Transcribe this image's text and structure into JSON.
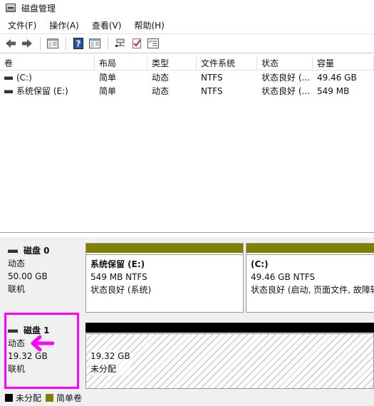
{
  "window": {
    "title": "磁盘管理"
  },
  "menu": [
    "文件(F)",
    "操作(A)",
    "查看(V)",
    "帮助(H)"
  ],
  "volumes": {
    "headers": [
      "卷",
      "布局",
      "类型",
      "文件系统",
      "状态",
      "容量"
    ],
    "rows": [
      {
        "name": "(C:)",
        "layout": "简单",
        "type": "动态",
        "fs": "NTFS",
        "status": "状态良好 (...",
        "capacity": "49.46 GB"
      },
      {
        "name": "系统保留 (E:)",
        "layout": "简单",
        "type": "动态",
        "fs": "NTFS",
        "status": "状态良好 (...",
        "capacity": "549 MB"
      }
    ]
  },
  "disks": [
    {
      "name": "磁盘 0",
      "type": "动态",
      "size": "50.00 GB",
      "state": "联机",
      "partitions": [
        {
          "name": "系统保留  (E:)",
          "size": "549 MB NTFS",
          "status": "状态良好 (系统)"
        },
        {
          "name": "(C:)",
          "size": "49.46 GB NTFS",
          "status": "状态良好 (启动, 页面文件, 故障转"
        }
      ]
    },
    {
      "name": "磁盘 1",
      "type": "动态",
      "size": "19.32 GB",
      "state": "联机",
      "unallocated": {
        "size": "19.32 GB",
        "label": "未分配"
      }
    }
  ],
  "legend": [
    {
      "label": "未分配",
      "color": "#000000"
    },
    {
      "label": "简单卷",
      "color": "#808000"
    }
  ],
  "colors": {
    "simple_volume_bar": "#808000",
    "unallocated_bar": "#000000",
    "annotation": "#ff00ff"
  },
  "icons": [
    "back-arrow-icon",
    "forward-arrow-icon",
    "console-tree-icon",
    "help-icon",
    "properties-icon",
    "connect-icon",
    "check-icon",
    "settings-list-icon"
  ]
}
